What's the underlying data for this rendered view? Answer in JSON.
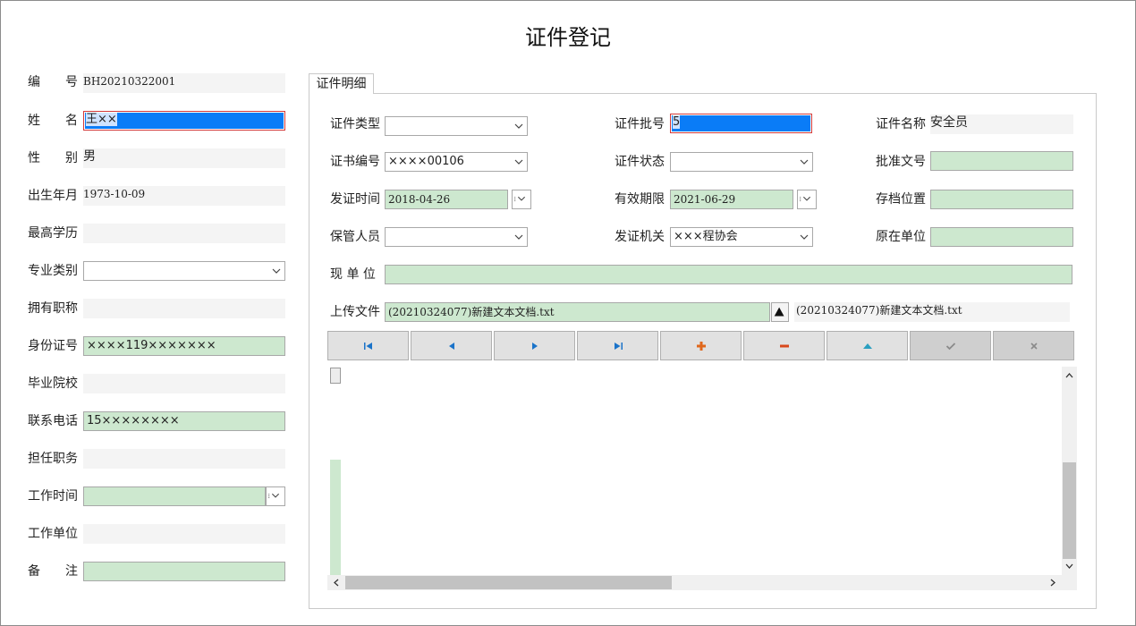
{
  "window": {
    "title": "证件登记"
  },
  "left_form": {
    "code": {
      "label_a": "编",
      "label_b": "号",
      "value": "BH20210322001"
    },
    "name": {
      "label_a": "姓",
      "label_b": "名",
      "value": "王××"
    },
    "gender": {
      "label_a": "性",
      "label_b": "别",
      "value": "男"
    },
    "birth": {
      "label": "出生年月",
      "value": "1973-10-09"
    },
    "education": {
      "label": "最高学历",
      "value": ""
    },
    "major": {
      "label": "专业类别",
      "value": ""
    },
    "title": {
      "label": "拥有职称",
      "value": ""
    },
    "id_number": {
      "label": "身份证号",
      "value": "××××119×××××××"
    },
    "school": {
      "label": "毕业院校",
      "value": ""
    },
    "phone": {
      "label": "联系电话",
      "value": "15××××××××"
    },
    "position": {
      "label": "担任职务",
      "value": ""
    },
    "work_time": {
      "label": "工作时间",
      "value": ""
    },
    "work_unit": {
      "label": "工作单位",
      "value": ""
    },
    "remark": {
      "label_a": "备",
      "label_b": "注",
      "value": ""
    }
  },
  "tab": {
    "label": "证件明细"
  },
  "detail": {
    "cert_type": {
      "label": "证件类型",
      "value": ""
    },
    "cert_batch": {
      "label": "证件批号",
      "value": "5"
    },
    "cert_name": {
      "label": "证件名称",
      "value": "安全员"
    },
    "cert_no": {
      "label": "证书编号",
      "value": "××××00106"
    },
    "cert_status": {
      "label": "证件状态",
      "value": ""
    },
    "approval_no": {
      "label": "批准文号",
      "value": ""
    },
    "issue_date": {
      "label": "发证时间",
      "value": "2018-04-26"
    },
    "valid_until": {
      "label": "有效期限",
      "value": "2021-06-29"
    },
    "archive_loc": {
      "label": "存档位置",
      "value": ""
    },
    "keeper": {
      "label": "保管人员",
      "value": ""
    },
    "issuer": {
      "label": "发证机关",
      "value": "×××程协会"
    },
    "orig_unit": {
      "label": "原在单位",
      "value": ""
    },
    "current_unit": {
      "label": "现 单 位",
      "value": ""
    },
    "upload": {
      "label": "上传文件",
      "value": "(20210324077)新建文本文档.txt",
      "display": "(20210324077)新建文本文档.txt"
    }
  },
  "colors": {
    "field_green": "#cde8cf",
    "focus_blue": "#0a7cf7",
    "nav_blue": "#1a73c9",
    "plus_orange": "#e0671c",
    "minus_red": "#d9481c",
    "up_teal": "#2a9fc0"
  },
  "icons": [
    "first-record-icon",
    "prev-record-icon",
    "next-record-icon",
    "last-record-icon",
    "add-icon",
    "delete-icon",
    "edit-icon",
    "post-icon",
    "cancel-icon"
  ]
}
